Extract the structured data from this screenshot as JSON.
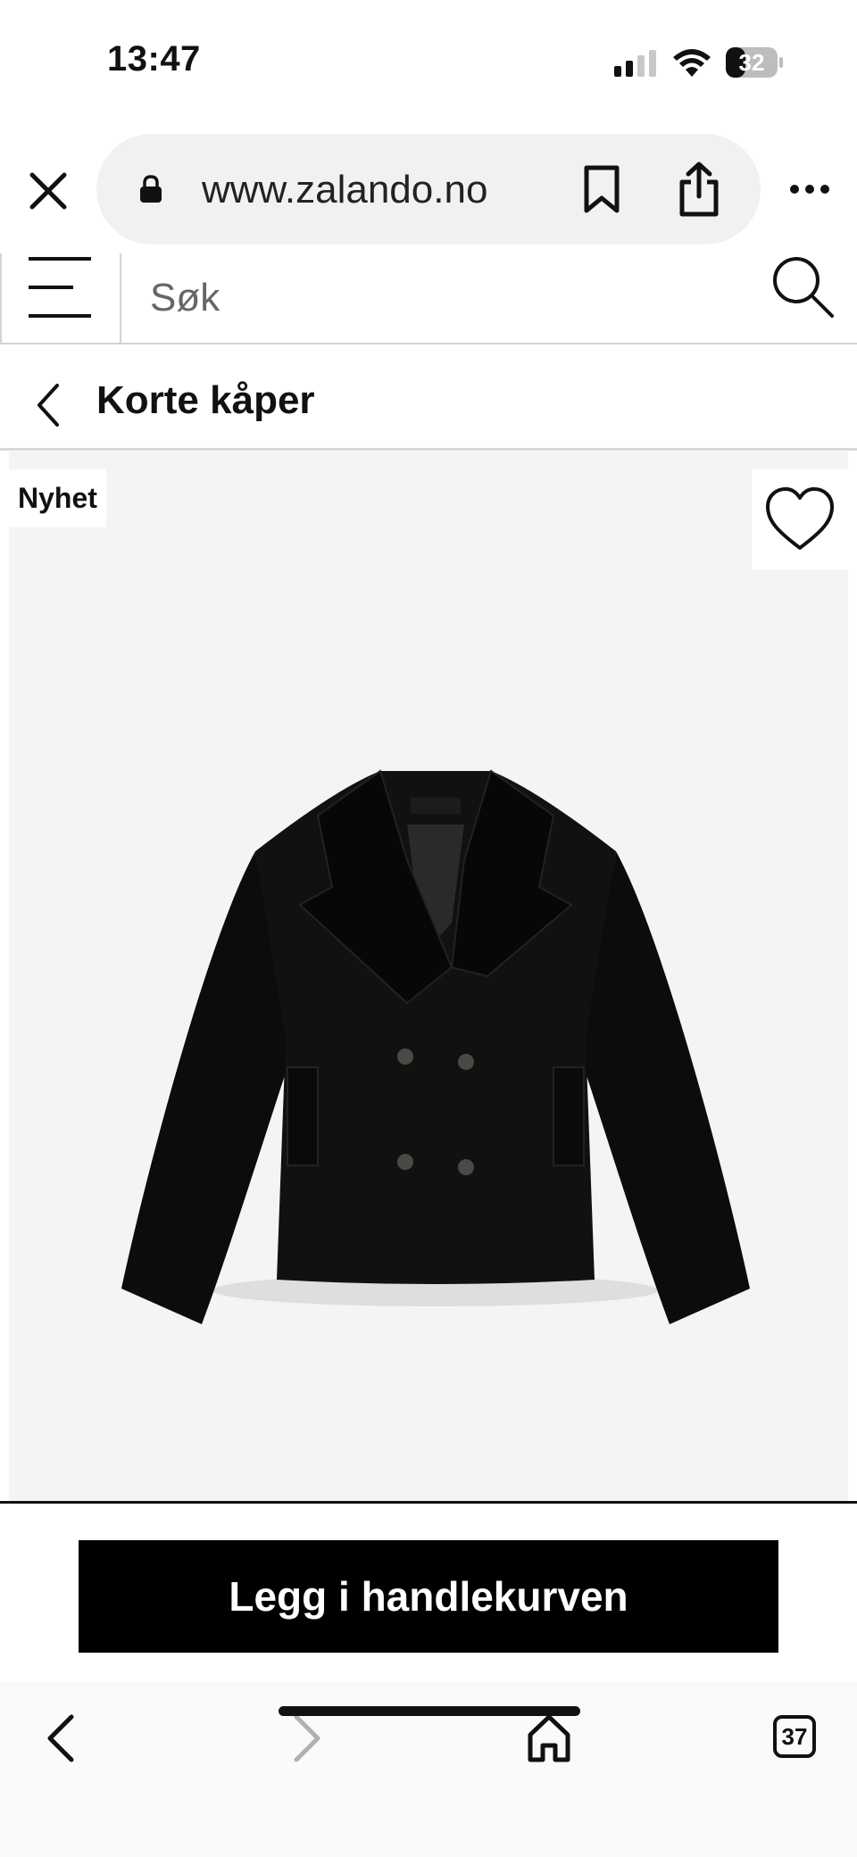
{
  "status_bar": {
    "time": "13:47",
    "battery": "32"
  },
  "browser": {
    "url": "www.zalando.no",
    "tab_count": "37"
  },
  "search": {
    "placeholder": "Søk"
  },
  "page": {
    "title": "Korte kåper"
  },
  "product": {
    "badge": "Nyhet",
    "cta_label": "Legg i handlekurven"
  },
  "colors": {
    "accent": "#000000",
    "image_bg": "#f4f4f4",
    "disabled_icon": "#b0b0b0"
  },
  "icons": [
    "close-icon",
    "lock-icon",
    "bookmark-icon",
    "share-icon",
    "more-icon",
    "menu-icon",
    "search-icon",
    "chevron-left-icon",
    "heart-icon",
    "chevron-right-icon",
    "home-icon",
    "tabs-icon"
  ]
}
